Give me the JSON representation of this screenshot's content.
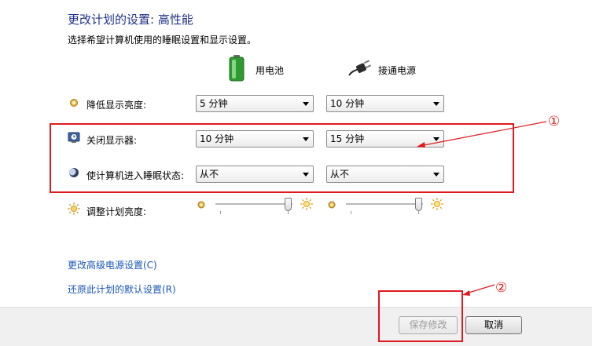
{
  "header": {
    "title": "更改计划的设置: 高性能",
    "subtitle": "选择希望计算机使用的睡眠设置和显示设置。"
  },
  "columns": {
    "battery": {
      "label": "用电池",
      "icon": "battery-icon"
    },
    "plugged": {
      "label": "接通电源",
      "icon": "power-plug-icon"
    }
  },
  "rows": {
    "dim": {
      "label": "降低显示亮度:",
      "battery_value": "5 分钟",
      "plugged_value": "10 分钟",
      "icon": "brightness-low-icon"
    },
    "display_off": {
      "label": "关闭显示器:",
      "battery_value": "10 分钟",
      "plugged_value": "15 分钟",
      "icon": "monitor-clock-icon"
    },
    "sleep": {
      "label": "使计算机进入睡眠状态:",
      "battery_value": "从不",
      "plugged_value": "从不",
      "icon": "moon-icon"
    },
    "brightness": {
      "label": "调整计划亮度:",
      "icon": "sun-icon",
      "battery_level": 1.0,
      "plugged_level": 1.0
    }
  },
  "links": {
    "advanced": "更改高级电源设置(C)",
    "restore": "还原此计划的默认设置(R)"
  },
  "buttons": {
    "save": "保存修改",
    "cancel": "取消"
  },
  "annotations": {
    "callout_1": "①",
    "callout_2": "②",
    "color": "#e0191e"
  }
}
